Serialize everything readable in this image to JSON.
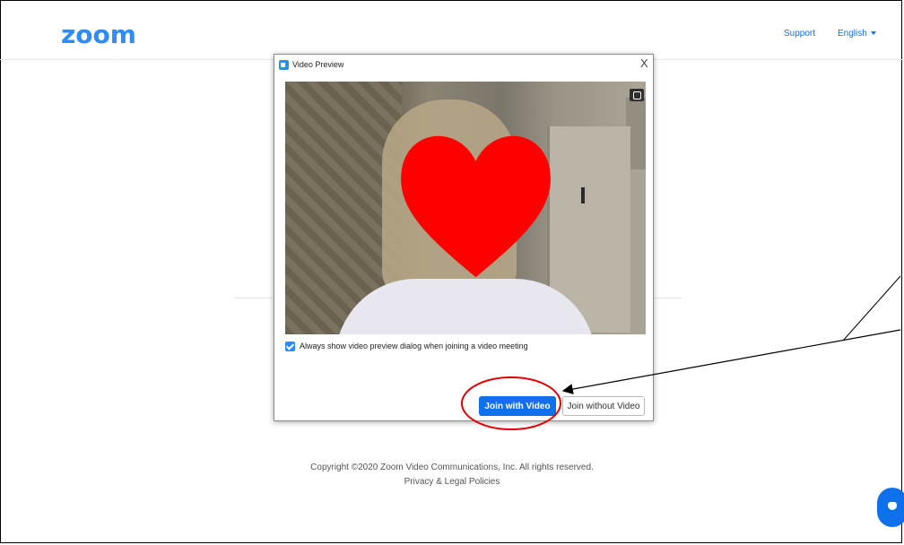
{
  "header": {
    "logo_text": "zoom",
    "support_label": "Support",
    "language_label": "English"
  },
  "dialog": {
    "title": "Video Preview",
    "close_glyph": "X",
    "checkbox_label": "Always show video preview dialog when joining a video meeting",
    "checkbox_checked": true,
    "join_with_video_label": "Join with Video",
    "join_without_video_label": "Join without Video"
  },
  "footer": {
    "copyright": "Copyright ©2020 Zoom Video Communications, Inc. All rights reserved.",
    "policies_link": "Privacy & Legal Policies"
  },
  "colors": {
    "brand_blue": "#2d8cff",
    "button_blue": "#0e71eb",
    "annotation_red": "#e00000"
  },
  "icons": {
    "video_dialog_icon": "zoom-camera-icon",
    "background_toggle": "virtual-background-icon",
    "help_chat": "chat-bubble-icon"
  }
}
